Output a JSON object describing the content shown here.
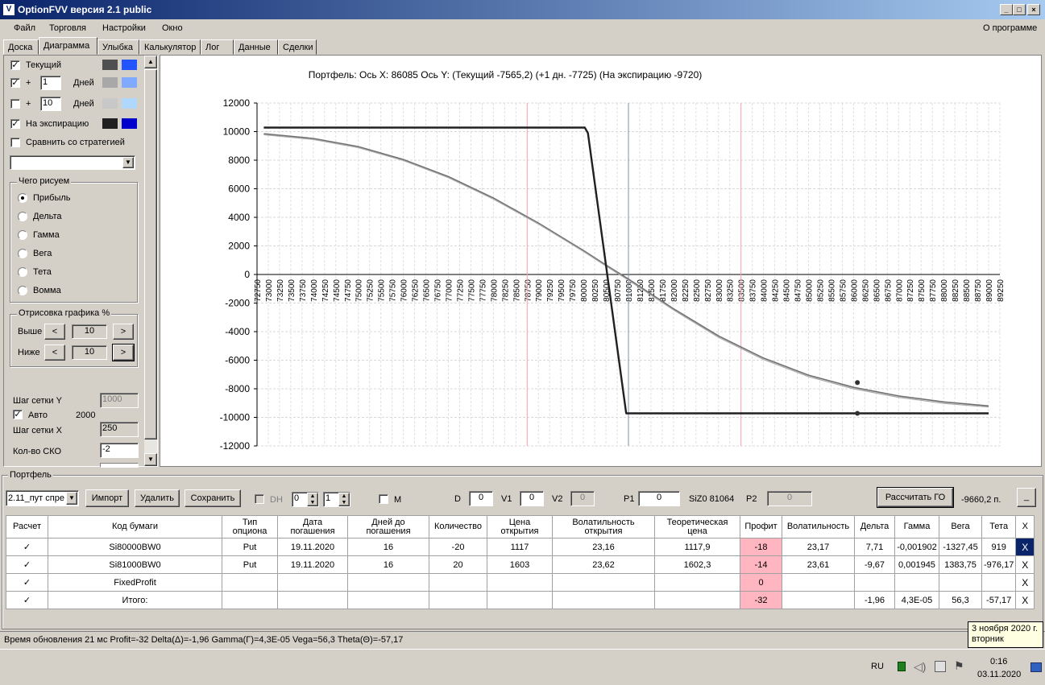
{
  "window": {
    "title": "OptionFVV версия 2.1 public",
    "controls": [
      "_",
      "□",
      "×"
    ]
  },
  "menu": {
    "items": [
      "Файл",
      "Торговля",
      "Настройки",
      "Окно"
    ],
    "about": "О программе"
  },
  "tabs": [
    "Доска",
    "Диаграмма",
    "Улыбка",
    "Калькулятор",
    "Лог",
    "Данные",
    "Сделки"
  ],
  "active_tab": "Диаграмма",
  "left": {
    "current_label": "Текущий",
    "plus_sign": "+",
    "days1": "1",
    "days_label": "Дней",
    "days2": "10",
    "expiry_label": "На экспирацию",
    "compare_label": "Сравнить со стратегией",
    "what_group": "Чего рисуем",
    "radios": [
      "Прибыль",
      "Дельта",
      "Гамма",
      "Вега",
      "Тета",
      "Вомма"
    ],
    "render_group": "Отрисовка графика %",
    "above_label": "Выше",
    "above_value": "10",
    "below_label": "Ниже",
    "below_value": "10",
    "arrow_left": "<",
    "arrow_right": ">",
    "grid_y_label": "Шаг сетки Y",
    "grid_y_value": "1000",
    "auto_label": "Авто",
    "auto_value": "2000",
    "grid_x_label": "Шаг сетки X",
    "grid_x_value": "250",
    "sko_label": "Кол-во СКО",
    "sko_value": "-2",
    "check_mark": "✓",
    "colors": {
      "current": [
        "#505050",
        "#2255ff"
      ],
      "plus1": [
        "#a8a8a8",
        "#80aaff"
      ],
      "plus10": [
        "#c8c8c8",
        "#b0d8ff"
      ],
      "expiry": [
        "#202020",
        "#0000cc"
      ]
    }
  },
  "chart_data": {
    "type": "line",
    "title": "Портфель:  Ось X: 86085 Ось Y:   (Текущий -7565,2)  (+1 дн. -7725)  (На экспирацию -9720)",
    "xlim": [
      72750,
      89250
    ],
    "ylim": [
      -12000,
      12000
    ],
    "y_ticks": [
      12000,
      10000,
      8000,
      6000,
      4000,
      2000,
      0,
      -2000,
      -4000,
      -6000,
      -8000,
      -10000,
      -12000
    ],
    "x_ticks": [
      72750,
      73000,
      73250,
      73500,
      73750,
      74000,
      74250,
      74500,
      74750,
      75000,
      75250,
      75500,
      75750,
      76000,
      76250,
      76500,
      76750,
      77000,
      77250,
      77500,
      77750,
      78000,
      78250,
      78500,
      78750,
      79000,
      79250,
      79500,
      79750,
      80000,
      80250,
      80500,
      80750,
      81000,
      81250,
      81500,
      81750,
      82000,
      82250,
      82500,
      82750,
      83000,
      83250,
      83500,
      83750,
      84000,
      84250,
      84500,
      84750,
      85000,
      85250,
      85500,
      85750,
      86000,
      86250,
      86500,
      86750,
      87000,
      87250,
      87500,
      87750,
      88000,
      88250,
      88500,
      88750,
      89000,
      89250
    ],
    "grid": true,
    "vlines": [
      {
        "x": 78750,
        "color": "#ff9fb0"
      },
      {
        "x": 81000,
        "color": "#8090b0"
      },
      {
        "x": 83500,
        "color": "#ff9fb0"
      }
    ],
    "series": [
      {
        "name": "Текущий",
        "color": "#707070",
        "x": [
          72900,
          74000,
          75000,
          76000,
          77000,
          78000,
          79000,
          80000,
          80500,
          81000,
          82000,
          83000,
          84000,
          85000,
          86000,
          87000,
          88000,
          89000
        ],
        "y": [
          9850,
          9520,
          8950,
          8050,
          6850,
          5350,
          3600,
          1680,
          660,
          -320,
          -2400,
          -4300,
          -5850,
          -7050,
          -7900,
          -8500,
          -8920,
          -9200
        ]
      },
      {
        "name": "+1 дн.",
        "color": "#a8a8a8",
        "x": [
          72900,
          74000,
          75000,
          76000,
          77000,
          78000,
          79000,
          80000,
          80500,
          81000,
          82000,
          83000,
          84000,
          85000,
          86000,
          87000,
          88000,
          89000
        ],
        "y": [
          9780,
          9450,
          8880,
          7980,
          6780,
          5280,
          3530,
          1610,
          590,
          -400,
          -2480,
          -4400,
          -5950,
          -7150,
          -8000,
          -8600,
          -9020,
          -9280
        ]
      },
      {
        "name": "На экспирацию",
        "color": "#202020",
        "x": [
          72900,
          80030,
          80100,
          80950,
          81000,
          89000
        ],
        "y": [
          10280,
          10280,
          9900,
          -9720,
          -9720,
          -9720
        ]
      }
    ],
    "markers": [
      {
        "x": 86085,
        "y": -7565
      },
      {
        "x": 86085,
        "y": -9720
      }
    ]
  },
  "portfolio": {
    "label": "Портфель",
    "selector": "2.11_пут спре",
    "import": "Импорт",
    "delete": "Удалить",
    "save": "Сохранить",
    "dh_label": "DH",
    "spin1": "0",
    "spin2": "1",
    "m_label": "M",
    "d_label": "D",
    "d_value": "0",
    "v1_label": "V1",
    "v1_value": "0",
    "v2_label": "V2",
    "v2_value": "0",
    "p1_label": "P1",
    "p1_value": "0",
    "si_label": "SiZ0 81064",
    "p2_label": "P2",
    "p2_value": "0",
    "calc_go": "Рассчитать ГО",
    "go_value": "-9660,2 п.",
    "minimize": "_"
  },
  "table": {
    "headers": [
      "Расчет",
      "Код бумаги",
      "Тип\nопциона",
      "Дата\nпогашения",
      "Дней до\nпогашения",
      "Количество",
      "Цена\nоткрытия",
      "Волатильность\nоткрытия",
      "Теоретическая\nцена",
      "Профит",
      "Волатильность",
      "Дельта",
      "Гамма",
      "Вега",
      "Тета",
      "X"
    ],
    "rows": [
      [
        "✓",
        "Si80000BW0",
        "Put",
        "19.11.2020",
        "16",
        "-20",
        "1117",
        "23,16",
        "1117,9",
        "-18",
        "23,17",
        "7,71",
        "-0,001902",
        "-1327,45",
        "919",
        "X"
      ],
      [
        "✓",
        "Si81000BW0",
        "Put",
        "19.11.2020",
        "16",
        "20",
        "1603",
        "23,62",
        "1602,3",
        "-14",
        "23,61",
        "-9,67",
        "0,001945",
        "1383,75",
        "-976,17",
        "X"
      ],
      [
        "✓",
        "FixedProfit",
        "",
        "",
        "",
        "",
        "",
        "",
        "",
        "0",
        "",
        "",
        "",
        "",
        "",
        "X"
      ],
      [
        "✓",
        "Итого:",
        "",
        "",
        "",
        "",
        "",
        "",
        "",
        "-32",
        "",
        "-1,96",
        "4,3E-05",
        "56,3",
        "-57,17",
        "X"
      ]
    ]
  },
  "status": {
    "text": "Время обновления 21 мс  Profit=-32 Delta(Δ)=-1,96 Gamma(Γ)=4,3E-05 Vega=56,3 Theta(Θ)=-57,17"
  },
  "taskbar": {
    "lang": "RU",
    "time": "0:16",
    "date": "03.11.2020"
  },
  "tooltip": {
    "line1": "3 ноября 2020 г.",
    "line2": "вторник"
  }
}
